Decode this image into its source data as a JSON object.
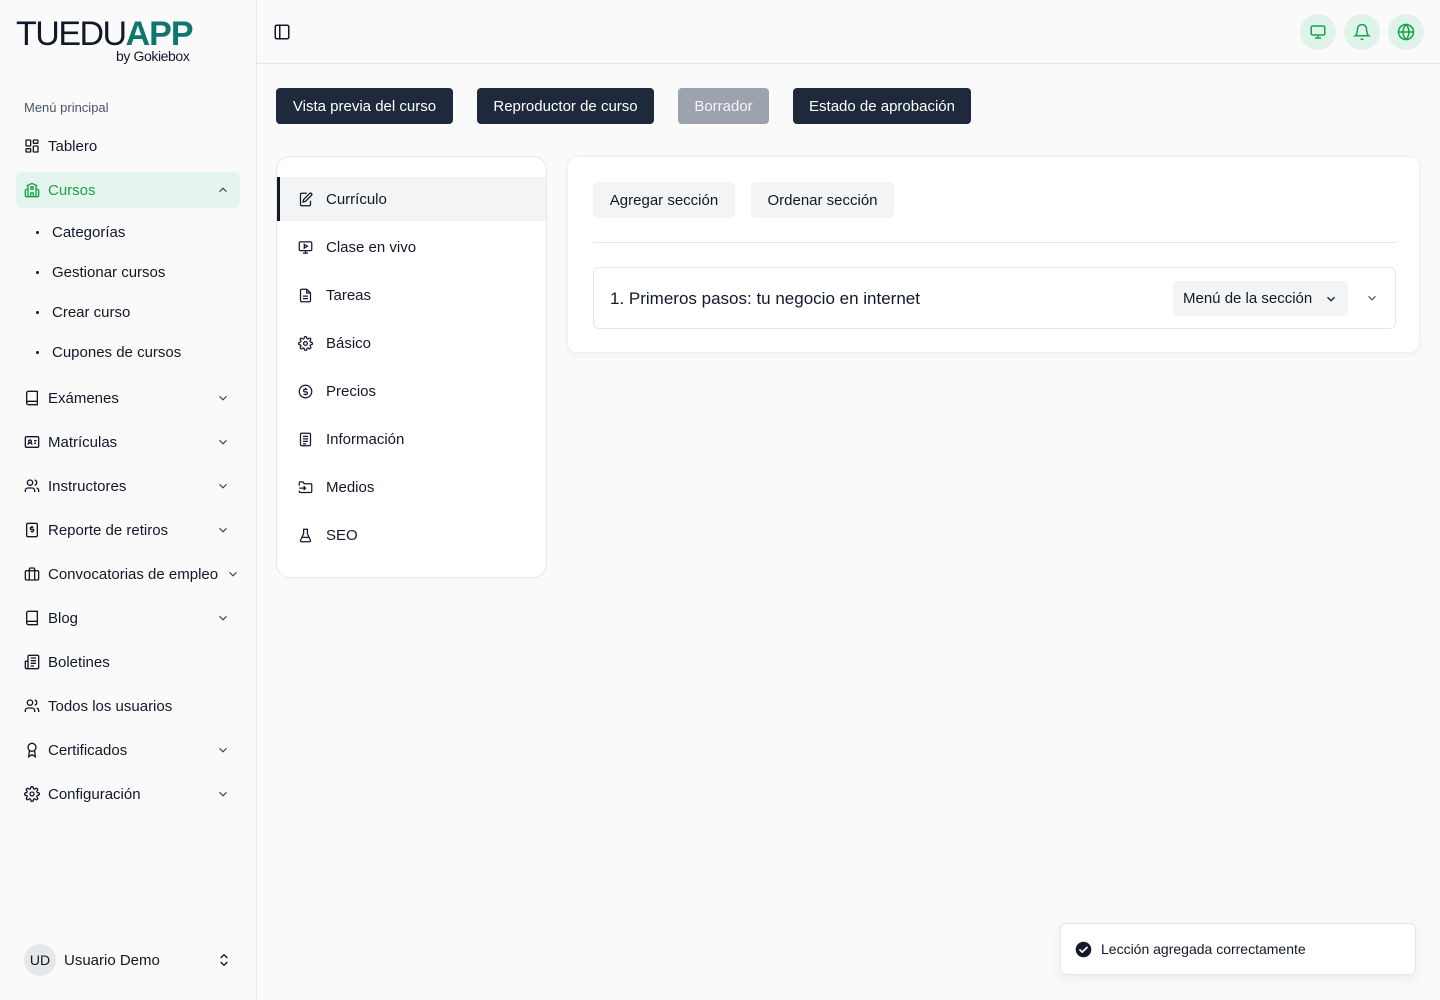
{
  "brand": {
    "name_part1": "TUEDU",
    "name_part2": "APP",
    "byline": "by Gokiebox"
  },
  "sidebar": {
    "section_label": "Menú principal",
    "items": [
      {
        "label": "Tablero",
        "icon": "dashboard-icon"
      },
      {
        "label": "Cursos",
        "icon": "school-icon",
        "active": true,
        "expanded": true,
        "children": [
          {
            "label": "Categorías"
          },
          {
            "label": "Gestionar cursos"
          },
          {
            "label": "Crear curso"
          },
          {
            "label": "Cupones de cursos"
          }
        ]
      },
      {
        "label": "Exámenes",
        "icon": "book-icon",
        "has_submenu": true
      },
      {
        "label": "Matrículas",
        "icon": "id-card-icon",
        "has_submenu": true
      },
      {
        "label": "Instructores",
        "icon": "users-icon",
        "has_submenu": true
      },
      {
        "label": "Reporte de retiros",
        "icon": "receipt-icon",
        "has_submenu": true
      },
      {
        "label": "Convocatorias de empleo",
        "icon": "briefcase-icon",
        "has_submenu": true
      },
      {
        "label": "Blog",
        "icon": "book-open-icon",
        "has_submenu": true
      },
      {
        "label": "Boletines",
        "icon": "newspaper-icon"
      },
      {
        "label": "Todos los usuarios",
        "icon": "users-icon"
      },
      {
        "label": "Certificados",
        "icon": "award-icon",
        "has_submenu": true
      },
      {
        "label": "Configuración",
        "icon": "gear-icon",
        "has_submenu": true
      }
    ],
    "user": {
      "initials": "UD",
      "name": "Usuario Demo"
    }
  },
  "header": {
    "icons": [
      "monitor-icon",
      "bell-icon",
      "globe-icon"
    ]
  },
  "toolbar": {
    "preview": "Vista previa del curso",
    "player": "Reproductor de curso",
    "draft": "Borrador",
    "approval": "Estado de aprobación"
  },
  "tabs": [
    {
      "label": "Currículo",
      "icon": "edit-icon",
      "active": true
    },
    {
      "label": "Clase en vivo",
      "icon": "live-icon"
    },
    {
      "label": "Tareas",
      "icon": "file-icon"
    },
    {
      "label": "Básico",
      "icon": "gear-icon"
    },
    {
      "label": "Precios",
      "icon": "dollar-icon"
    },
    {
      "label": "Información",
      "icon": "list-icon"
    },
    {
      "label": "Medios",
      "icon": "folder-icon"
    },
    {
      "label": "SEO",
      "icon": "flask-icon"
    }
  ],
  "curriculum": {
    "add_section": "Agregar sección",
    "sort_section": "Ordenar sección",
    "sections": [
      {
        "title": "1. Primeros pasos: tu negocio en internet",
        "menu_label": "Menú de la sección"
      }
    ]
  },
  "toast": {
    "message": "Lección agregada correctamente"
  },
  "colors": {
    "accent": "#16a34a",
    "brand_teal": "#0f766e",
    "dark_button": "#1e293b",
    "disabled_button": "#9ca3af",
    "active_bg": "#e6f4ee"
  }
}
